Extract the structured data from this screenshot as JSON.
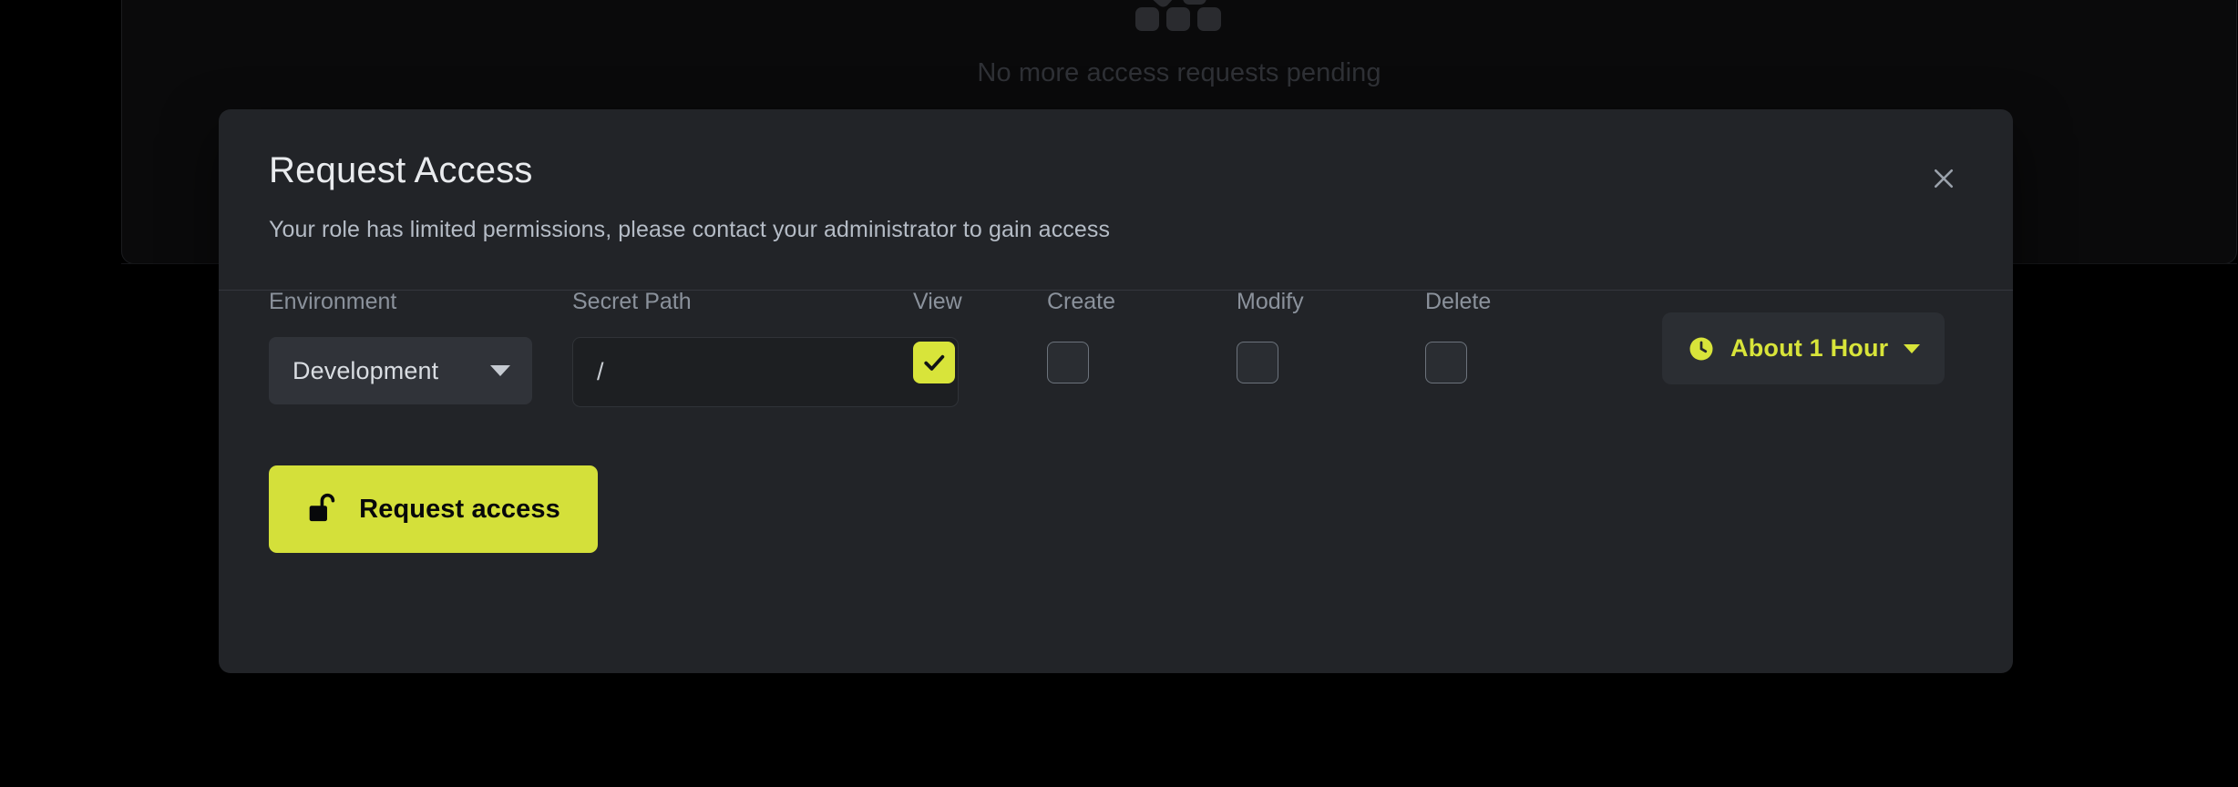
{
  "background": {
    "empty_state_text": "No more access requests pending",
    "empty_state_icon": "stacked-blocks-icon"
  },
  "modal": {
    "title": "Request Access",
    "subtitle": "Your role has limited permissions, please contact your administrator to gain access",
    "close_icon": "close-icon",
    "form": {
      "environment": {
        "label": "Environment",
        "value": "Development",
        "chevron_icon": "chevron-down-icon"
      },
      "secret_path": {
        "label": "Secret Path",
        "value": "/",
        "placeholder": "/",
        "chevron_icon": "chevron-down-icon"
      },
      "permissions": [
        {
          "label": "View",
          "checked": true,
          "name": "view"
        },
        {
          "label": "Create",
          "checked": false,
          "name": "create"
        },
        {
          "label": "Modify",
          "checked": false,
          "name": "modify"
        },
        {
          "label": "Delete",
          "checked": false,
          "name": "delete"
        }
      ],
      "duration": {
        "value": "About 1 Hour",
        "clock_icon": "clock-icon",
        "chevron_icon": "chevron-down-icon"
      }
    },
    "submit": {
      "label": "Request access",
      "icon": "unlock-icon"
    }
  },
  "colors": {
    "accent": "#d4e03a",
    "accent_text": "#d8e43a",
    "modal_bg": "#222428",
    "page_bg": "#000000",
    "label_text": "#8b929c",
    "title_text": "#e9ebee",
    "subtitle_text": "#b5bcc6"
  }
}
